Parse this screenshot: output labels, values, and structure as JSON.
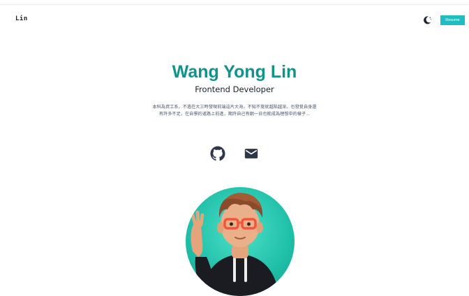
{
  "nav": {
    "logo": "Lin",
    "theme_toggle_icon": "moon-icon",
    "resume_label": "Resume"
  },
  "hero": {
    "name": "Wang Yong Lin",
    "role": "Frontend Developer",
    "bio": "本科為資工系，不過在大三時發現前端這片大海，不知不覺就越陷越深。也發覺自身還有許多不足，在自學的道路上前進，期許自己有朝一日也能成為理想中的樣子..."
  },
  "socials": [
    {
      "icon": "github-icon"
    },
    {
      "icon": "email-icon"
    }
  ],
  "colors": {
    "accent": "#13928a",
    "button": "#1fbcc2",
    "avatar_bg": "#1fbfa8",
    "icon": "#2d3748"
  }
}
